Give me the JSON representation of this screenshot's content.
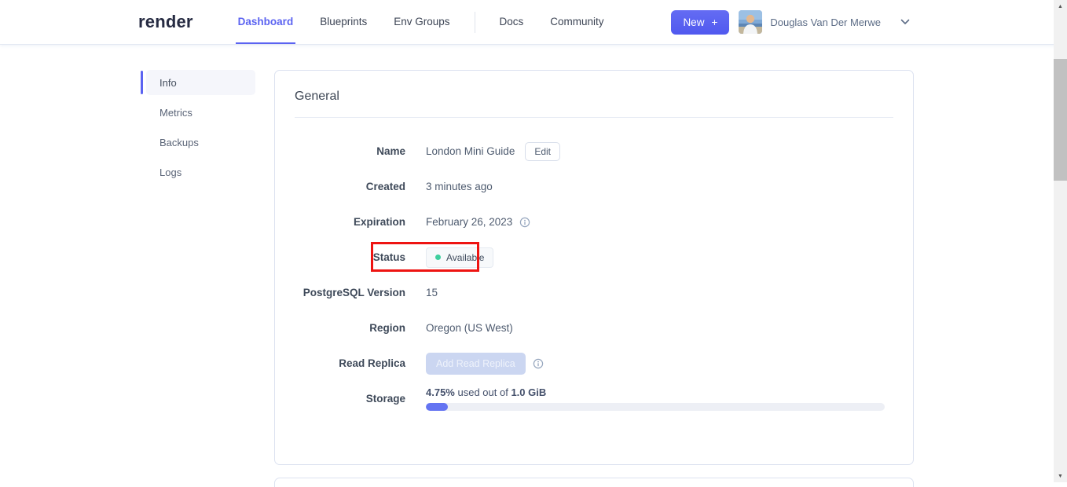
{
  "colors": {
    "accent": "#5b63f1",
    "status_dot_green": "#3ecf9e",
    "annotation_red": "#ee1412",
    "progress_fill": "#6474f2"
  },
  "header": {
    "logo": "render",
    "nav": [
      {
        "label": "Dashboard",
        "active": true
      },
      {
        "label": "Blueprints",
        "active": false
      },
      {
        "label": "Env Groups",
        "active": false
      },
      {
        "label": "Docs",
        "active": false
      },
      {
        "label": "Community",
        "active": false
      }
    ],
    "new_button_label": "New",
    "new_button_plus": "+",
    "user_name": "Douglas Van Der Merwe"
  },
  "sidebar": {
    "items": [
      {
        "label": "Info",
        "active": true
      },
      {
        "label": "Metrics",
        "active": false
      },
      {
        "label": "Backups",
        "active": false
      },
      {
        "label": "Logs",
        "active": false
      }
    ]
  },
  "general": {
    "title": "General",
    "name_label": "Name",
    "name_value": "London Mini Guide",
    "edit_button": "Edit",
    "created_label": "Created",
    "created_value": "3 minutes ago",
    "expiration_label": "Expiration",
    "expiration_value": "February 26, 2023",
    "status_label": "Status",
    "status_value": "Available",
    "version_label": "PostgreSQL Version",
    "version_value": "15",
    "region_label": "Region",
    "region_value": "Oregon (US West)",
    "replica_label": "Read Replica",
    "replica_button": "Add Read Replica",
    "storage_label": "Storage",
    "storage_used_pct": "4.75%",
    "storage_text_mid": " used out of ",
    "storage_total": "1.0 GiB",
    "storage_fill_pct": 4.75
  },
  "scrollbar": {
    "up_arrow": "▲",
    "down_arrow": "▼"
  }
}
